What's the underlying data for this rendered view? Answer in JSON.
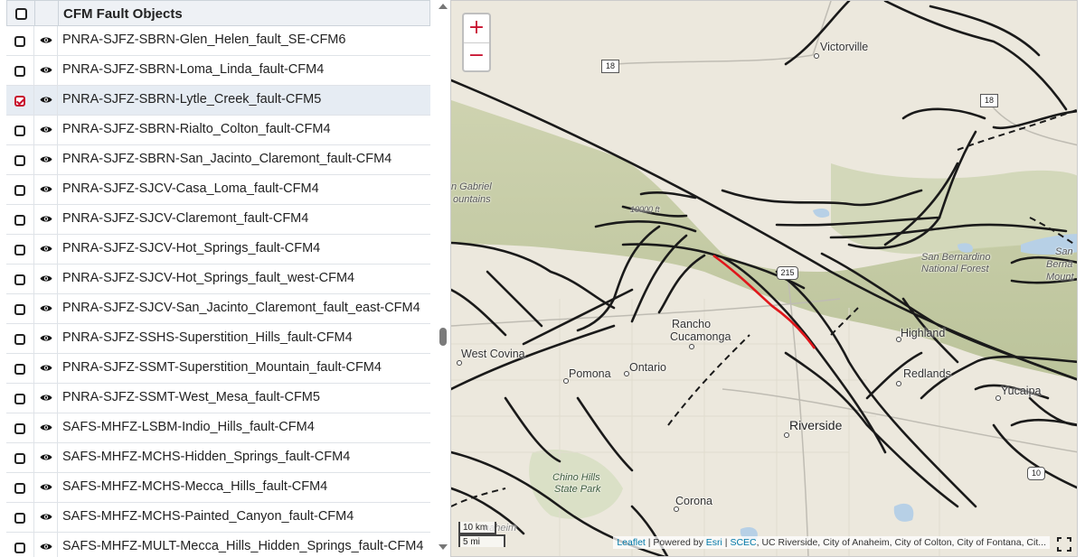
{
  "list": {
    "header_title": "CFM Fault Objects",
    "rows": [
      {
        "label": "PNRA-SJFZ-SBRN-Glen_Helen_fault_SE-CFM6",
        "checked": false
      },
      {
        "label": "PNRA-SJFZ-SBRN-Loma_Linda_fault-CFM4",
        "checked": false
      },
      {
        "label": "PNRA-SJFZ-SBRN-Lytle_Creek_fault-CFM5",
        "checked": true
      },
      {
        "label": "PNRA-SJFZ-SBRN-Rialto_Colton_fault-CFM4",
        "checked": false
      },
      {
        "label": "PNRA-SJFZ-SBRN-San_Jacinto_Claremont_fault-CFM4",
        "checked": false
      },
      {
        "label": "PNRA-SJFZ-SJCV-Casa_Loma_fault-CFM4",
        "checked": false
      },
      {
        "label": "PNRA-SJFZ-SJCV-Claremont_fault-CFM4",
        "checked": false
      },
      {
        "label": "PNRA-SJFZ-SJCV-Hot_Springs_fault-CFM4",
        "checked": false
      },
      {
        "label": "PNRA-SJFZ-SJCV-Hot_Springs_fault_west-CFM4",
        "checked": false
      },
      {
        "label": "PNRA-SJFZ-SJCV-San_Jacinto_Claremont_fault_east-CFM4",
        "checked": false
      },
      {
        "label": "PNRA-SJFZ-SSHS-Superstition_Hills_fault-CFM4",
        "checked": false
      },
      {
        "label": "PNRA-SJFZ-SSMT-Superstition_Mountain_fault-CFM4",
        "checked": false
      },
      {
        "label": "PNRA-SJFZ-SSMT-West_Mesa_fault-CFM5",
        "checked": false
      },
      {
        "label": "SAFS-MHFZ-LSBM-Indio_Hills_fault-CFM4",
        "checked": false
      },
      {
        "label": "SAFS-MHFZ-MCHS-Hidden_Springs_fault-CFM4",
        "checked": false
      },
      {
        "label": "SAFS-MHFZ-MCHS-Mecca_Hills_fault-CFM4",
        "checked": false
      },
      {
        "label": "SAFS-MHFZ-MCHS-Painted_Canyon_fault-CFM4",
        "checked": false
      },
      {
        "label": "SAFS-MHFZ-MULT-Mecca_Hills_Hidden_Springs_fault-CFM4",
        "checked": false
      }
    ]
  },
  "map": {
    "zoom_in": "+",
    "zoom_out": "−",
    "places": {
      "victorville": "Victorville",
      "san_gabriel": "n Gabriel",
      "mountains": "ountains",
      "contour": "10000 ft",
      "sb_forest_1": "San Bernardino",
      "sb_forest_2": "National Forest",
      "sb_right_1": "San",
      "sb_right_2": "Berna",
      "sb_right_3": "Mount",
      "rancho_1": "Rancho",
      "rancho_2": "Cucamonga",
      "west_covina": "West Covina",
      "pomona": "Pomona",
      "ontario": "Ontario",
      "highland": "Highland",
      "redlands": "Redlands",
      "yucaipa": "Yucaipa",
      "riverside": "Riverside",
      "chino_1": "Chino Hills",
      "chino_2": "State Park",
      "corona": "Corona",
      "anaheim": "naheim"
    },
    "shields": {
      "s18a": "18",
      "s18b": "18",
      "s215": "215",
      "s10": "10"
    },
    "scale": {
      "km": "10 km",
      "mi": "5 mi"
    },
    "attribution": {
      "leaflet": "Leaflet",
      "sep1": " | Powered by ",
      "esri": "Esri",
      "sep2": " | ",
      "scec": "SCEC",
      "rest": ", UC Riverside, City of Anaheim, City of Colton, City of Fontana, Cit..."
    },
    "colors": {
      "fault": "#1a1a1a",
      "selected_fault": "#e0161b",
      "accent": "#c8102e"
    }
  }
}
